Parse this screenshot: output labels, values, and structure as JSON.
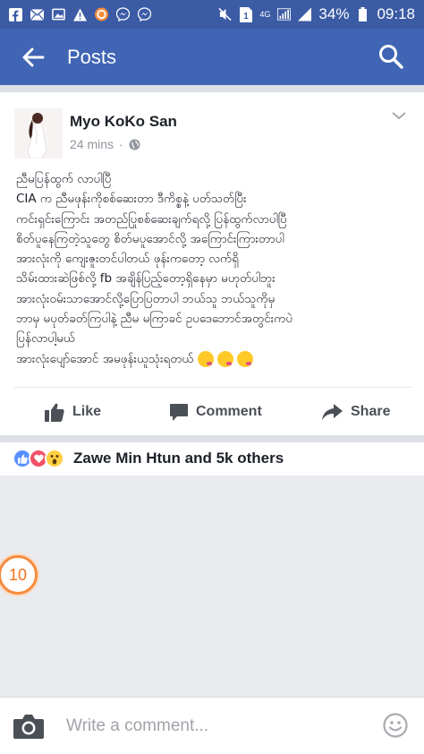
{
  "status_bar": {
    "icons": [
      "facebook-icon",
      "mail-icon",
      "photo-icon",
      "warning-icon",
      "app-icon",
      "messenger-icon",
      "messenger-icon"
    ],
    "network_label": "4G",
    "battery": "34%",
    "time": "09:18"
  },
  "app_bar": {
    "title": "Posts"
  },
  "post": {
    "author": "Myo KoKo San",
    "time": "24 mins",
    "privacy_icon": "globe-icon",
    "lines": [
      "ညီမပြန်ထွက် လာပါပြီ",
      "CIA က ညီမဖုန်းကိုစစ်ဆေးတာ ဒီကိစ္စနဲ့ ပတ်သတ်ပြီး",
      "ကင်းရှင်းကြောင်း အတည်ပြုစစ်ဆေးချက်ရလို့ ပြန်ထွက်လာပါပြီ",
      "စိတ်ပူနေကြတဲ့သူတွေ စိတ်မပူအောင်လို့ အကြောင်းကြားတာပါ",
      "အားလုံးကို ကျေးဇူးတင်ပါတယ် ဖုန်းကတော့ လက်ရှိ",
      "သိမ်းထားဆဲဖြစ်လို့ fb အချိန်ပြည့်တော့ရှိနေမှာ မဟုတ်ပါဘူး",
      "အားလုံးဝမ်းသာအောင်လို့ပြောပြတာပါ ဘယ်သူ ဘယ်သူကိုမှ",
      "ဘာမှ မပုတ်ခတ်ကြပါနဲ့ ညီမ မကြာခင် ဥပဒေဘောင်အတွင်းကပဲ",
      "ပြန်လာပါ့မယ်",
      "အားလုံးပျော်အောင် အမဖုန်းယူသုံးရတယ်"
    ]
  },
  "actions": {
    "like": "Like",
    "comment": "Comment",
    "share": "Share"
  },
  "reactions": {
    "text": "Zawe Min Htun and 5k others"
  },
  "badge": {
    "count": "10"
  },
  "composer": {
    "placeholder": "Write a comment..."
  },
  "colors": {
    "brand": "#4065b4",
    "status_bar": "#3b5ba5",
    "badge": "#f5731c"
  }
}
